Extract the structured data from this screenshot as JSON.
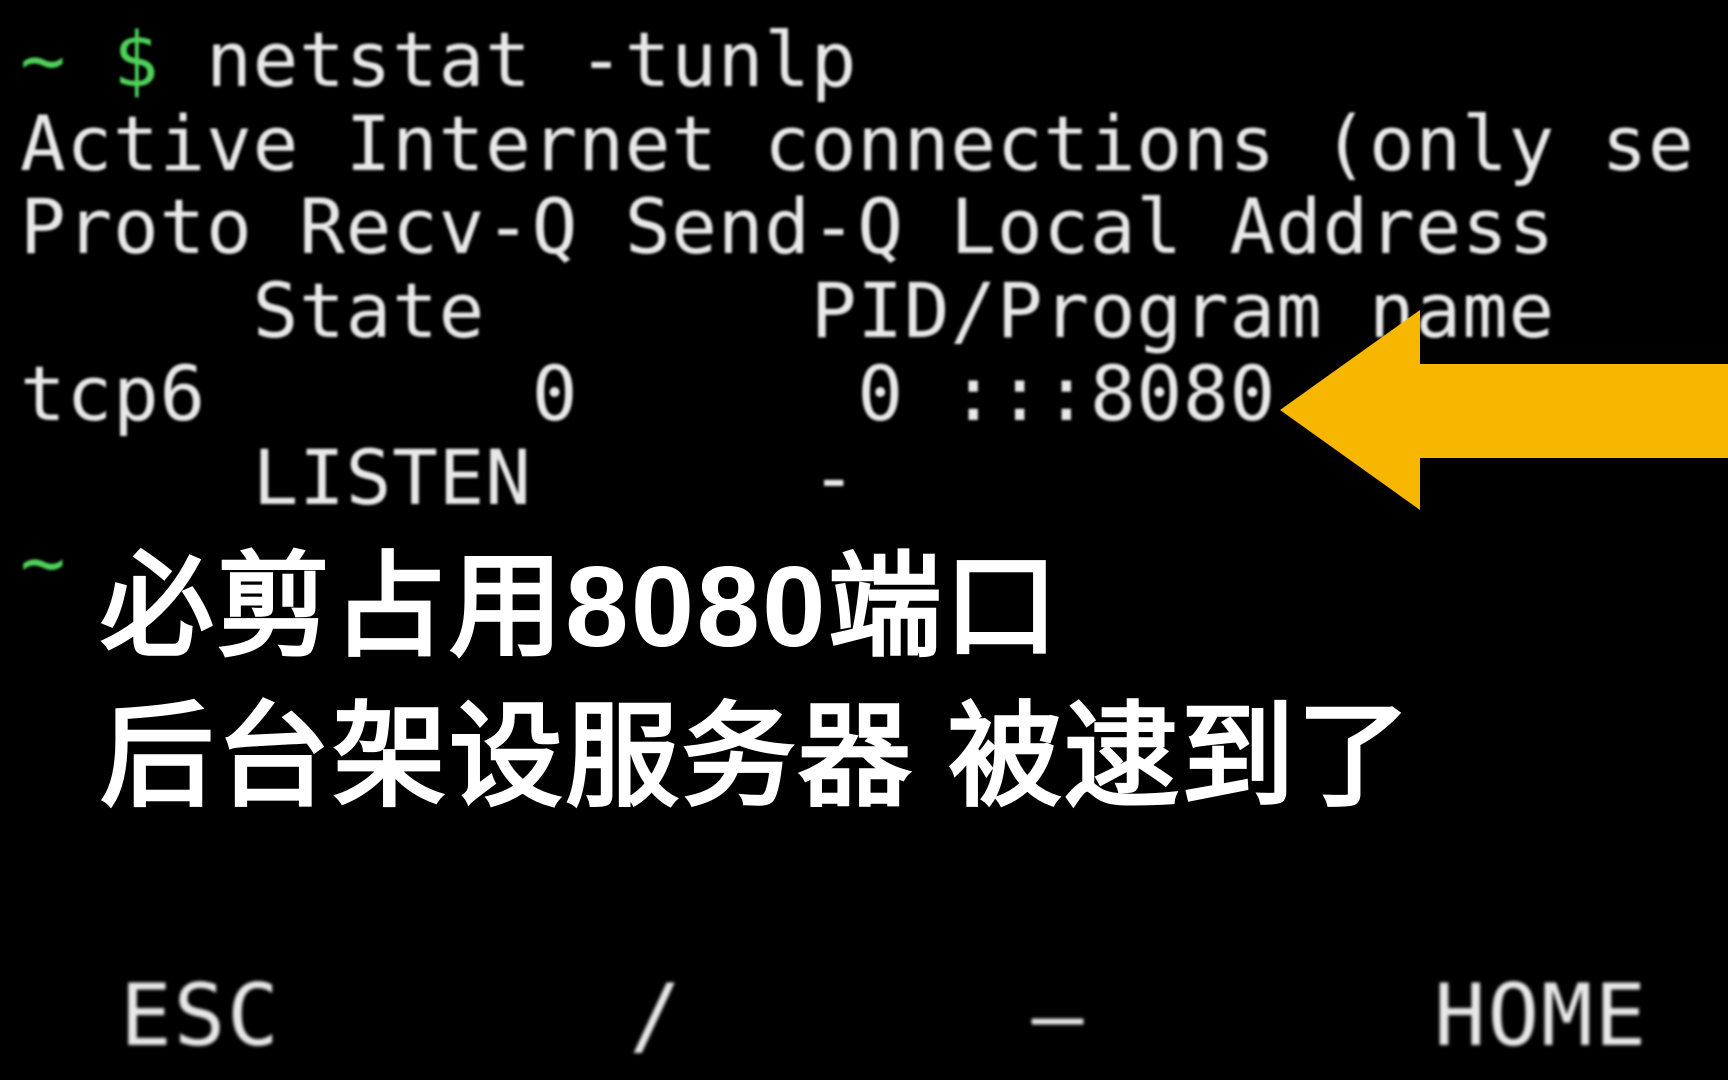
{
  "terminal": {
    "prompt_prefix": "~ $ ",
    "command": "netstat -tunlp",
    "out_line1": "Active Internet connections (only se",
    "out_line2": "Proto Recv-Q Send-Q Local Address",
    "out_line3_col1": "State",
    "out_line3_col2": "PID/Program name",
    "out_line4_proto": "tcp6",
    "out_line4_recv": "0",
    "out_line4_send": "0",
    "out_line4_addr": ":::8080",
    "out_line5_state": "LISTEN",
    "out_line5_pid": "-",
    "prompt_suffix": "~"
  },
  "overlay": {
    "line1": "必剪占用8080端口",
    "line2": "后台架设服务器  被逮到了"
  },
  "keys": {
    "esc": "ESC",
    "slash": "/",
    "dash": "—",
    "home": "HOME"
  },
  "colors": {
    "accent_arrow": "#f7b600",
    "prompt": "#4fd15a"
  }
}
